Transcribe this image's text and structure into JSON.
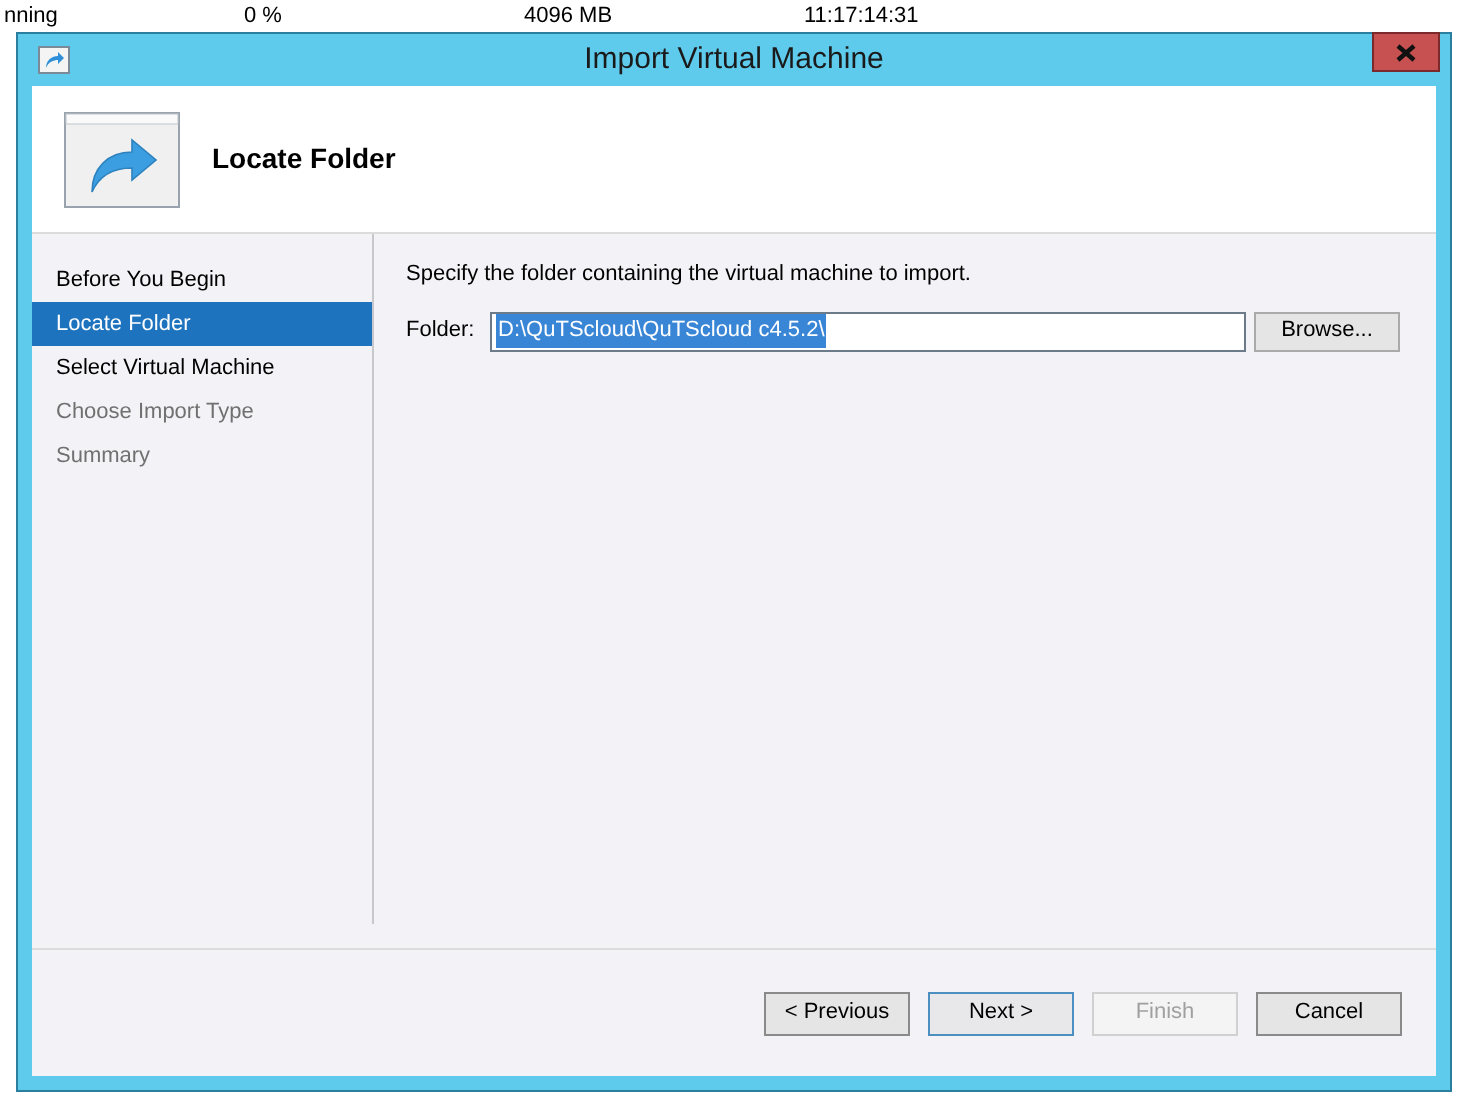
{
  "background_row": [
    "nning",
    "0 %",
    "4096 MB",
    "11:17:14:31"
  ],
  "window": {
    "title": "Import Virtual Machine"
  },
  "header": {
    "title": "Locate Folder"
  },
  "steps": [
    {
      "label": "Before You Begin",
      "selected": false,
      "disabled": false
    },
    {
      "label": "Locate Folder",
      "selected": true,
      "disabled": false
    },
    {
      "label": "Select Virtual Machine",
      "selected": false,
      "disabled": false
    },
    {
      "label": "Choose Import Type",
      "selected": false,
      "disabled": true
    },
    {
      "label": "Summary",
      "selected": false,
      "disabled": true
    }
  ],
  "instruction": "Specify the folder containing the virtual machine to import.",
  "folder": {
    "label": "Folder:",
    "value": "D:\\QuTScloud\\QuTScloud c4.5.2\\",
    "browse": "Browse..."
  },
  "buttons": [
    {
      "label": "< Previous",
      "disabled": false,
      "focused": false
    },
    {
      "label": "Next >",
      "disabled": false,
      "focused": true
    },
    {
      "label": "Finish",
      "disabled": true,
      "focused": false
    },
    {
      "label": "Cancel",
      "disabled": false,
      "focused": false
    }
  ]
}
